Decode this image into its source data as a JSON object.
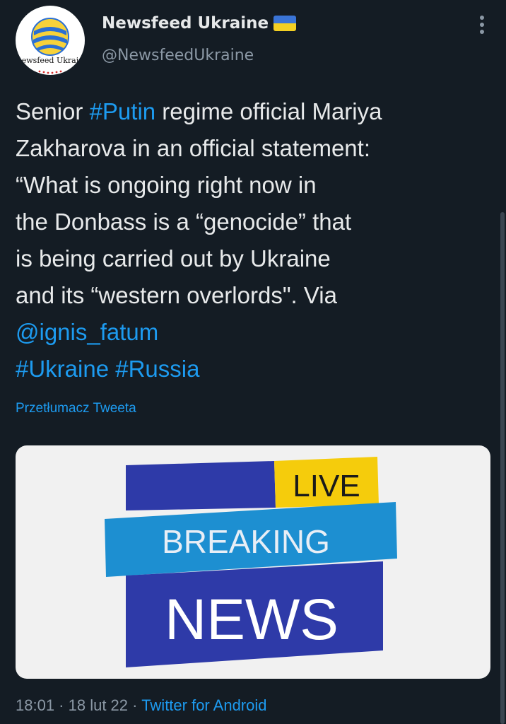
{
  "author": {
    "display_name": "Newsfeed Ukraine",
    "handle": "@NewsfeedUkraine",
    "avatar_text": "ewsfeed Ukrai",
    "flag_colors": [
      "#3a74d6",
      "#f3cf23"
    ]
  },
  "tweet": {
    "lines": [
      {
        "pre": "Senior ",
        "tag": "#Putin",
        "post": " regime official Mariya"
      },
      {
        "text": "Zakharova in an official statement:"
      },
      {
        "text": "“What is ongoing right now in"
      },
      {
        "text": "the Donbass is a “genocide” that"
      },
      {
        "text": "is being carried out by Ukraine"
      },
      {
        "text": "and its “western overlords\". Via"
      }
    ],
    "mention": "@ignis_fatum",
    "hashtag_ukraine": "#Ukraine",
    "hashtag_russia": "#Russia",
    "translate_label": "Przetłumacz Tweeta"
  },
  "media": {
    "live_label": "LIVE",
    "breaking_label": "BREAKING",
    "news_label": "NEWS",
    "colors": {
      "dark_blue": "#2e3aa8",
      "ribbon_blue": "#1d8fd1",
      "yellow": "#f5cc0c",
      "background": "#f1f1f1"
    }
  },
  "meta": {
    "time": "18:01",
    "date": "18 lut 22",
    "source": "Twitter for Android",
    "separator": " · "
  },
  "icons": {
    "more": "vertical-dots-icon",
    "verified_flag": "ukraine-flag-icon"
  }
}
